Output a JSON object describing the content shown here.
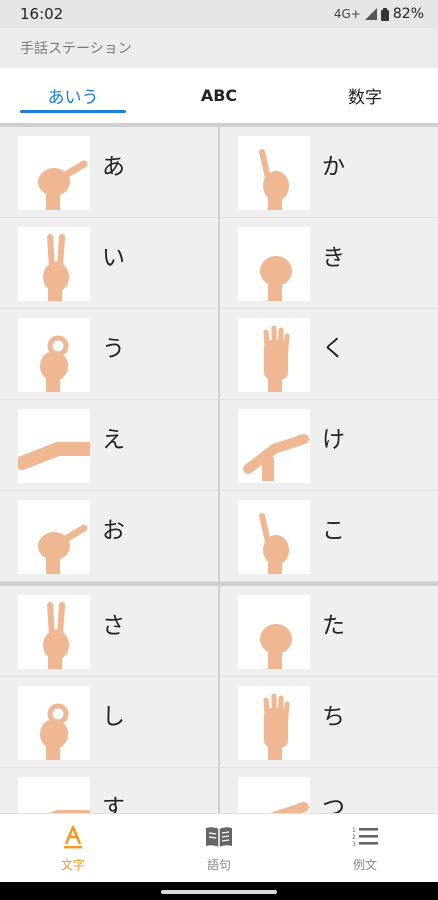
{
  "status": {
    "time": "16:02",
    "network": "4G+",
    "battery": "82%"
  },
  "app": {
    "title": "手話ステーション"
  },
  "tabs": [
    {
      "label": "あいう",
      "active": true
    },
    {
      "label": "ABC",
      "active": false
    },
    {
      "label": "数字",
      "active": false
    }
  ],
  "grid": {
    "rows": [
      {
        "left": {
          "kana": "あ",
          "icon": "hand-sign-a"
        },
        "right": {
          "kana": "か",
          "icon": "hand-sign-ka"
        }
      },
      {
        "left": {
          "kana": "い",
          "icon": "hand-sign-i"
        },
        "right": {
          "kana": "き",
          "icon": "hand-sign-ki"
        }
      },
      {
        "left": {
          "kana": "う",
          "icon": "hand-sign-u"
        },
        "right": {
          "kana": "く",
          "icon": "hand-sign-ku"
        }
      },
      {
        "left": {
          "kana": "え",
          "icon": "hand-sign-e"
        },
        "right": {
          "kana": "け",
          "icon": "hand-sign-ke"
        }
      },
      {
        "left": {
          "kana": "お",
          "icon": "hand-sign-o"
        },
        "right": {
          "kana": "こ",
          "icon": "hand-sign-ko"
        }
      },
      {
        "left": {
          "kana": "さ",
          "icon": "hand-sign-sa"
        },
        "right": {
          "kana": "た",
          "icon": "hand-sign-ta"
        }
      },
      {
        "left": {
          "kana": "し",
          "icon": "hand-sign-shi"
        },
        "right": {
          "kana": "ち",
          "icon": "hand-sign-chi"
        }
      },
      {
        "left": {
          "kana": "す",
          "icon": "hand-sign-su"
        },
        "right": {
          "kana": "つ",
          "icon": "hand-sign-tsu"
        }
      }
    ]
  },
  "bottom_nav": [
    {
      "label": "文字",
      "icon": "letter-a-icon",
      "active": true
    },
    {
      "label": "語句",
      "icon": "book-icon",
      "active": false
    },
    {
      "label": "例文",
      "icon": "numbered-list-icon",
      "active": false
    }
  ],
  "colors": {
    "accent_blue": "#1f7fd6",
    "accent_orange": "#f39a1c",
    "skin": "#efb792"
  }
}
